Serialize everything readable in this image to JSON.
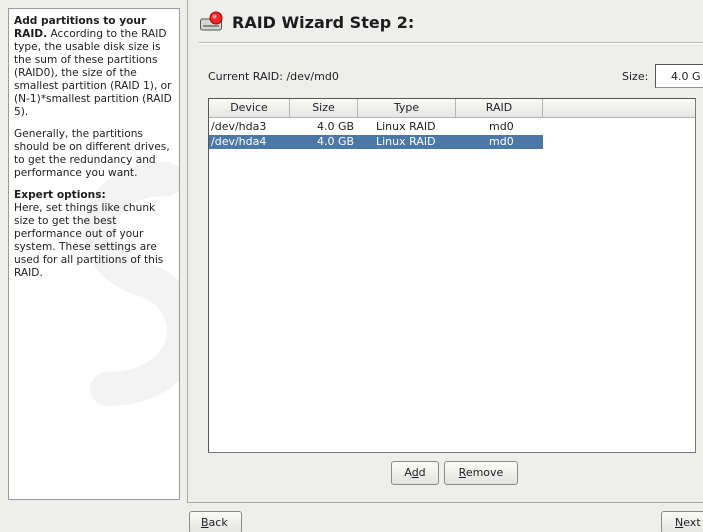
{
  "help": {
    "intro_bold": "Add partitions to your RAID.",
    "intro_text": " According to the RAID type, the usable disk size is the sum of these partitions (RAID0), the size of the smallest partition (RAID 1), or (N-1)*smallest partition (RAID 5).",
    "general": "Generally, the partitions should be on different drives, to get the redundancy and performance you want.",
    "expert_heading": "Expert options:",
    "expert_text": "Here, set things like chunk size to get the best performance out of your system. These settings are used for all partitions of this RAID."
  },
  "header": {
    "title": "RAID Wizard Step 2:",
    "icon": "harddisk-icon"
  },
  "raid": {
    "current_label": "Current RAID: /dev/md0",
    "size_label": "Size:",
    "size_value": "4.0 G"
  },
  "table": {
    "columns": [
      "Device",
      "Size",
      "Type",
      "RAID"
    ],
    "rows": [
      {
        "device": "/dev/hda3",
        "size": "4.0 GB",
        "type": "Linux RAID",
        "raid": "md0",
        "selected": false
      },
      {
        "device": "/dev/hda4",
        "size": "4.0 GB",
        "type": "Linux RAID",
        "raid": "md0",
        "selected": true
      }
    ]
  },
  "buttons": {
    "add": {
      "before": "A",
      "mnemonic": "d",
      "after": "d"
    },
    "remove": {
      "before": "",
      "mnemonic": "R",
      "after": "emove"
    },
    "back": {
      "before": "",
      "mnemonic": "B",
      "after": "ack"
    },
    "next": {
      "before": "",
      "mnemonic": "N",
      "after": "ext"
    }
  },
  "colors": {
    "selection": "#4c78a8",
    "background": "#eeeeec"
  }
}
